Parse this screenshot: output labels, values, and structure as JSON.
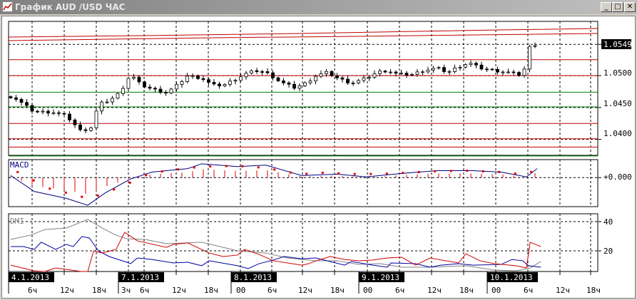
{
  "window": {
    "title": "График AUD /USD  ЧАС",
    "minimize": "_",
    "maximize": "□",
    "close": "✕"
  },
  "price_axis": {
    "labels": [
      "1.0549",
      "1.0500",
      "1.0450",
      "1.0400"
    ],
    "current": "1.0549"
  },
  "macd": {
    "label": "MACD",
    "zero_label": "+0.000"
  },
  "dmi": {
    "label": "DMI",
    "labels": [
      "40",
      "20"
    ]
  },
  "time_axis": {
    "hours": [
      "6ч",
      "12ч",
      "18ч",
      "3ч",
      "6ч",
      "12ч",
      "18ч",
      "00",
      "6ч",
      "12ч",
      "18ч",
      "00",
      "6ч",
      "12ч",
      "18ч",
      "00",
      "6ч",
      "12ч",
      "18ч"
    ],
    "dates": [
      "4.1.2013",
      "7.1.2013",
      "8.1.2013",
      "9.1.2013",
      "10.1.2013"
    ]
  },
  "colors": {
    "up_line": "#c00000",
    "green_line": "#008000",
    "macd_line": "#000080",
    "signal": "#dd0000",
    "adx": "#808080",
    "plus_di": "#0000a0",
    "minus_di": "#d00000"
  },
  "chart_data": {
    "type": "candlestick",
    "symbol": "AUD/USD",
    "timeframe": "H1",
    "price_close": [
      [
        0.4,
        1.0467
      ],
      [
        4.4,
        1.0443
      ],
      [
        7.7,
        1.0443
      ],
      [
        10.4,
        1.0437
      ],
      [
        13.1,
        1.0413
      ],
      [
        15.1,
        1.0419
      ],
      [
        16.4,
        1.0455
      ],
      [
        18.4,
        1.0461
      ],
      [
        20.4,
        1.0473
      ],
      [
        22.4,
        1.0502
      ],
      [
        24.4,
        1.0485
      ],
      [
        26.4,
        1.0479
      ],
      [
        29.1,
        1.0473
      ],
      [
        31.1,
        1.0485
      ],
      [
        33.1,
        1.05
      ],
      [
        35.7,
        1.0496
      ],
      [
        37.7,
        1.0485
      ],
      [
        39.7,
        1.0485
      ],
      [
        42.4,
        1.0496
      ],
      [
        44.4,
        1.0505
      ],
      [
        46.4,
        1.0508
      ],
      [
        48.4,
        1.0502
      ],
      [
        50.4,
        1.049
      ],
      [
        53.1,
        1.0481
      ],
      [
        55.1,
        1.0488
      ],
      [
        57.1,
        1.05
      ],
      [
        59.1,
        1.0505
      ],
      [
        61.1,
        1.0496
      ],
      [
        63.7,
        1.0488
      ],
      [
        66.4,
        1.0496
      ],
      [
        68.4,
        1.0505
      ],
      [
        70.4,
        1.0508
      ],
      [
        72.4,
        1.0502
      ],
      [
        75.1,
        1.0502
      ],
      [
        77.1,
        1.0508
      ],
      [
        79.7,
        1.0512
      ],
      [
        81.7,
        1.0505
      ],
      [
        83.7,
        1.0514
      ],
      [
        85.7,
        1.052
      ],
      [
        87.7,
        1.0512
      ],
      [
        90.4,
        1.0508
      ],
      [
        93.1,
        1.0505
      ],
      [
        95.7,
        1.05
      ],
      [
        97.1,
        1.0548
      ],
      [
        98.4,
        1.0549
      ]
    ],
    "price_range": [
      1.0375,
      1.0585
    ],
    "levels": [
      {
        "price": 1.0525,
        "color": "red"
      },
      {
        "price": 1.05,
        "color": "red"
      },
      {
        "price": 1.0474,
        "color": "green"
      },
      {
        "price": 1.0451,
        "color": "green"
      },
      {
        "price": 1.0425,
        "color": "red"
      },
      {
        "price": 1.0401,
        "color": "red"
      },
      {
        "price": 1.0388,
        "color": "red"
      },
      {
        "price": 1.0374,
        "color": "green"
      }
    ],
    "macd_line": [
      [
        0,
        0.0003
      ],
      [
        4.4,
        -0.002
      ],
      [
        10.4,
        -0.003
      ],
      [
        14.4,
        -0.004
      ],
      [
        17.7,
        -0.0022
      ],
      [
        22.4,
        -0.0002
      ],
      [
        26.4,
        0.0008
      ],
      [
        33.1,
        0.0013
      ],
      [
        35.7,
        0.002
      ],
      [
        42.4,
        0.0016
      ],
      [
        47.7,
        0.0018
      ],
      [
        54.4,
        0.0003
      ],
      [
        61.1,
        0.0005
      ],
      [
        66.4,
        0.0001
      ],
      [
        73.1,
        0.0006
      ],
      [
        79.7,
        0.001
      ],
      [
        86.4,
        0.001
      ],
      [
        91.7,
        0.0008
      ],
      [
        96.4,
        0.0001
      ],
      [
        98.4,
        0.0013
      ]
    ],
    "macd_signal": [
      [
        1.3,
        0.0008
      ],
      [
        2.4,
        0.0004
      ],
      [
        3.3,
        0
      ],
      [
        5.5,
        -0.0009
      ],
      [
        6.4,
        -0.0013
      ],
      [
        7.3,
        -0.0016
      ],
      [
        10.4,
        -0.0022
      ],
      [
        12.4,
        -0.0026
      ],
      [
        14.4,
        -0.003
      ],
      [
        15.7,
        -0.0028
      ],
      [
        17.7,
        -0.0022
      ],
      [
        19.7,
        -0.0016
      ],
      [
        22.4,
        -0.0007
      ],
      [
        25.1,
        0.0003
      ],
      [
        26.4,
        0.0007
      ],
      [
        30.4,
        0.0011
      ],
      [
        35.7,
        0.0016
      ],
      [
        42.4,
        0.0017
      ],
      [
        47.7,
        0.0014
      ],
      [
        51.7,
        0.0008
      ],
      [
        54.4,
        0.0005
      ],
      [
        58.4,
        0.0007
      ],
      [
        65.1,
        0.0005
      ],
      [
        71.7,
        0.0006
      ],
      [
        78.4,
        0.0009
      ],
      [
        85.1,
        0.001
      ],
      [
        91.7,
        0.0008
      ],
      [
        96.4,
        0.0004
      ],
      [
        97.7,
        0.001
      ],
      [
        99.1,
        0.0012
      ]
    ],
    "macd_range": [
      -0.0042,
      0.0026
    ],
    "dmi_adx": [
      [
        0,
        27.8
      ],
      [
        3.7,
        30.7
      ],
      [
        6.4,
        34.6
      ],
      [
        10.4,
        35.6
      ],
      [
        14.4,
        41.5
      ],
      [
        17.1,
        35.6
      ],
      [
        19.7,
        30.7
      ],
      [
        21.7,
        28.3
      ],
      [
        25.1,
        27.8
      ],
      [
        29.1,
        24.9
      ],
      [
        35.7,
        25.9
      ],
      [
        42.4,
        20
      ],
      [
        47.7,
        18.5
      ],
      [
        51.7,
        15.1
      ],
      [
        57.1,
        13.2
      ],
      [
        61.1,
        13.2
      ],
      [
        65.1,
        10.7
      ],
      [
        69.1,
        11.2
      ],
      [
        73.1,
        8.8
      ],
      [
        78.4,
        8.8
      ],
      [
        85.1,
        9.8
      ],
      [
        90.4,
        6.8
      ],
      [
        94.4,
        6.3
      ],
      [
        97.1,
        8.3
      ],
      [
        99.1,
        12.7
      ]
    ],
    "dmi_plus": [
      [
        0,
        22.9
      ],
      [
        2.4,
        22.9
      ],
      [
        4.4,
        21
      ],
      [
        5.7,
        25.9
      ],
      [
        8.4,
        21
      ],
      [
        10.4,
        24.4
      ],
      [
        11.7,
        22.9
      ],
      [
        13.3,
        29.8
      ],
      [
        14.7,
        28.8
      ],
      [
        16.4,
        20
      ],
      [
        18.4,
        16.1
      ],
      [
        21.7,
        12.2
      ],
      [
        22.4,
        11.2
      ],
      [
        23.7,
        15.1
      ],
      [
        26.4,
        14.1
      ],
      [
        30.4,
        11.7
      ],
      [
        33.1,
        12.2
      ],
      [
        35.7,
        9.8
      ],
      [
        37.1,
        13.2
      ],
      [
        42.4,
        9.8
      ],
      [
        44.4,
        7.8
      ],
      [
        46.4,
        11.2
      ],
      [
        49.1,
        13.7
      ],
      [
        51.1,
        16.1
      ],
      [
        54.4,
        14.6
      ],
      [
        57.1,
        15.1
      ],
      [
        59.7,
        12.7
      ],
      [
        62.4,
        10.2
      ],
      [
        63.7,
        12.7
      ],
      [
        67.7,
        10.2
      ],
      [
        70.4,
        8.8
      ],
      [
        71.1,
        11.7
      ],
      [
        75.7,
        11.2
      ],
      [
        78.4,
        8.8
      ],
      [
        80.4,
        10.2
      ],
      [
        83.7,
        11.2
      ],
      [
        86.4,
        10.2
      ],
      [
        91.7,
        10.7
      ],
      [
        93.7,
        14.1
      ],
      [
        95.7,
        13.2
      ],
      [
        96.8,
        9.8
      ],
      [
        99.1,
        8.8
      ]
    ],
    "dmi_minus": [
      [
        0,
        10.2
      ],
      [
        4.4,
        6.3
      ],
      [
        6.4,
        3.4
      ],
      [
        8.4,
        8.3
      ],
      [
        10.4,
        7.3
      ],
      [
        13.1,
        3.9
      ],
      [
        14.4,
        5.4
      ],
      [
        15.5,
        20
      ],
      [
        17.1,
        18.5
      ],
      [
        19.7,
        21
      ],
      [
        21.3,
        32.7
      ],
      [
        23.7,
        26.8
      ],
      [
        29.1,
        22.4
      ],
      [
        30.4,
        24.4
      ],
      [
        33.1,
        25.4
      ],
      [
        37.1,
        18.5
      ],
      [
        39.7,
        16.1
      ],
      [
        42.4,
        17.1
      ],
      [
        43.7,
        21
      ],
      [
        46.4,
        17.6
      ],
      [
        49.1,
        13.2
      ],
      [
        54.4,
        10.2
      ],
      [
        55.7,
        11.2
      ],
      [
        57.1,
        13.2
      ],
      [
        59.7,
        16.1
      ],
      [
        62.4,
        14.1
      ],
      [
        65.1,
        13.2
      ],
      [
        67.7,
        13.7
      ],
      [
        70.4,
        15.1
      ],
      [
        73.1,
        15.6
      ],
      [
        75.7,
        10.2
      ],
      [
        78.4,
        15.1
      ],
      [
        83.7,
        11.7
      ],
      [
        85.1,
        18
      ],
      [
        87.7,
        13.2
      ],
      [
        90.4,
        11.2
      ],
      [
        94.4,
        9.8
      ],
      [
        96.4,
        8.3
      ],
      [
        97.1,
        25.9
      ],
      [
        99.1,
        22.9
      ]
    ],
    "dmi_range": [
      0,
      45
    ]
  }
}
